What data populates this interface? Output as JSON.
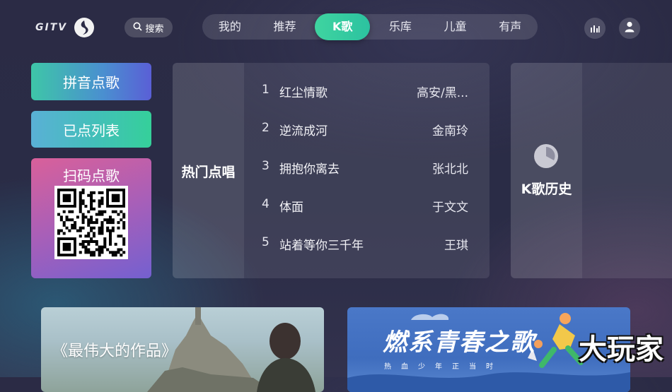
{
  "header": {
    "logo_text": "GITV",
    "search_label": "搜索",
    "tabs": [
      {
        "label": "我的"
      },
      {
        "label": "推荐"
      },
      {
        "label": "K歌"
      },
      {
        "label": "乐库"
      },
      {
        "label": "儿童"
      },
      {
        "label": "有声"
      }
    ],
    "active_tab": "K歌",
    "right_icons": [
      "equalizer-icon",
      "user-icon"
    ]
  },
  "quick_actions": {
    "pinyin_label": "拼音点歌",
    "ordered_label": "已点列表",
    "scan_label": "扫码点歌"
  },
  "hot_songs": {
    "title": "热门点唱",
    "songs": [
      {
        "rank": "1",
        "name": "红尘情歌",
        "artist": "高安/黑..."
      },
      {
        "rank": "2",
        "name": "逆流成河",
        "artist": "金南玲"
      },
      {
        "rank": "3",
        "name": "拥抱你离去",
        "artist": "张北北"
      },
      {
        "rank": "4",
        "name": "体面",
        "artist": "于文文"
      },
      {
        "rank": "5",
        "name": "站着等你三千年",
        "artist": "王琪"
      }
    ]
  },
  "history": {
    "title": "K歌历史",
    "icon": "clock-icon"
  },
  "banners": {
    "left_title": "《最伟大的作品》",
    "right_title": "燃系青春之歌",
    "right_subtitle": "热血少年正当时"
  },
  "watermark": "大玩家",
  "colors": {
    "accent": "#34cfa0",
    "background": "#2b2b45"
  }
}
